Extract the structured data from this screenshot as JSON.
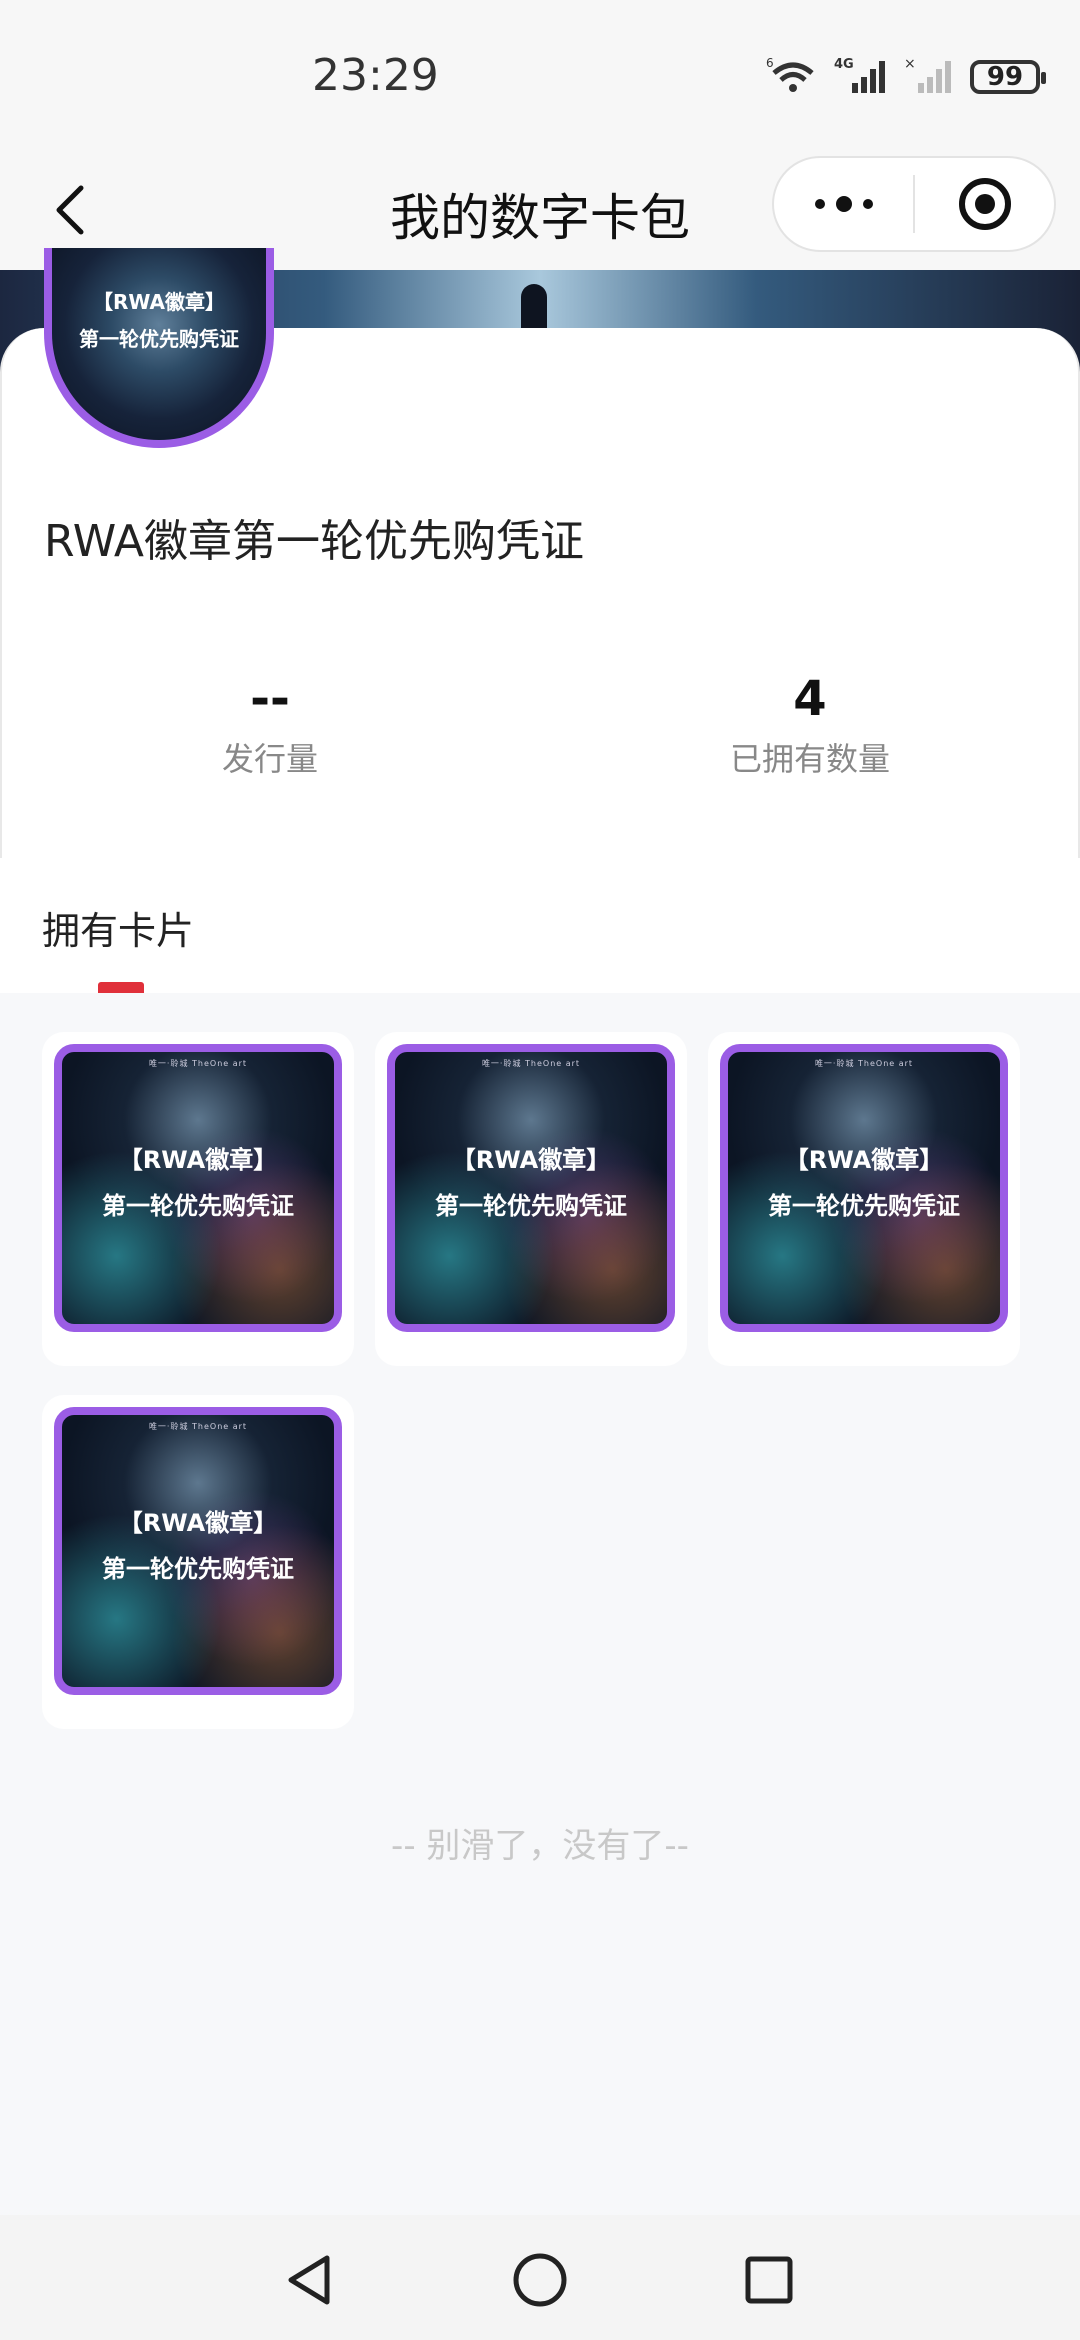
{
  "status_bar": {
    "time": "23:29",
    "battery": "99",
    "network": "4G",
    "wifi_badge": "6"
  },
  "nav": {
    "title": "我的数字卡包",
    "back_icon": "chevron-left-icon",
    "more_icon": "more-dots-icon",
    "close_icon": "target-circle-icon"
  },
  "collection": {
    "avatar_line1": "【RWA徽章】",
    "avatar_line2": "第一轮优先购凭证",
    "title": "RWA徽章第一轮优先购凭证",
    "stats": [
      {
        "value": "--",
        "label": "发行量"
      },
      {
        "value": "4",
        "label": "已拥有数量"
      }
    ]
  },
  "owned": {
    "heading": "拥有卡片",
    "cards": [
      {
        "brand": "唯一·聆城   TheOne art",
        "line1": "【RWA徽章】",
        "line2": "第一轮优先购凭证"
      },
      {
        "brand": "唯一·聆城   TheOne art",
        "line1": "【RWA徽章】",
        "line2": "第一轮优先购凭证"
      },
      {
        "brand": "唯一·聆城   TheOne art",
        "line1": "【RWA徽章】",
        "line2": "第一轮优先购凭证"
      },
      {
        "brand": "唯一·聆城   TheOne art",
        "line1": "【RWA徽章】",
        "line2": "第一轮优先购凭证"
      }
    ],
    "end_note": "-- 别滑了，没有了--"
  },
  "colors": {
    "accent_purple": "#9b5de5",
    "tab_indicator_red": "#e0303a"
  }
}
